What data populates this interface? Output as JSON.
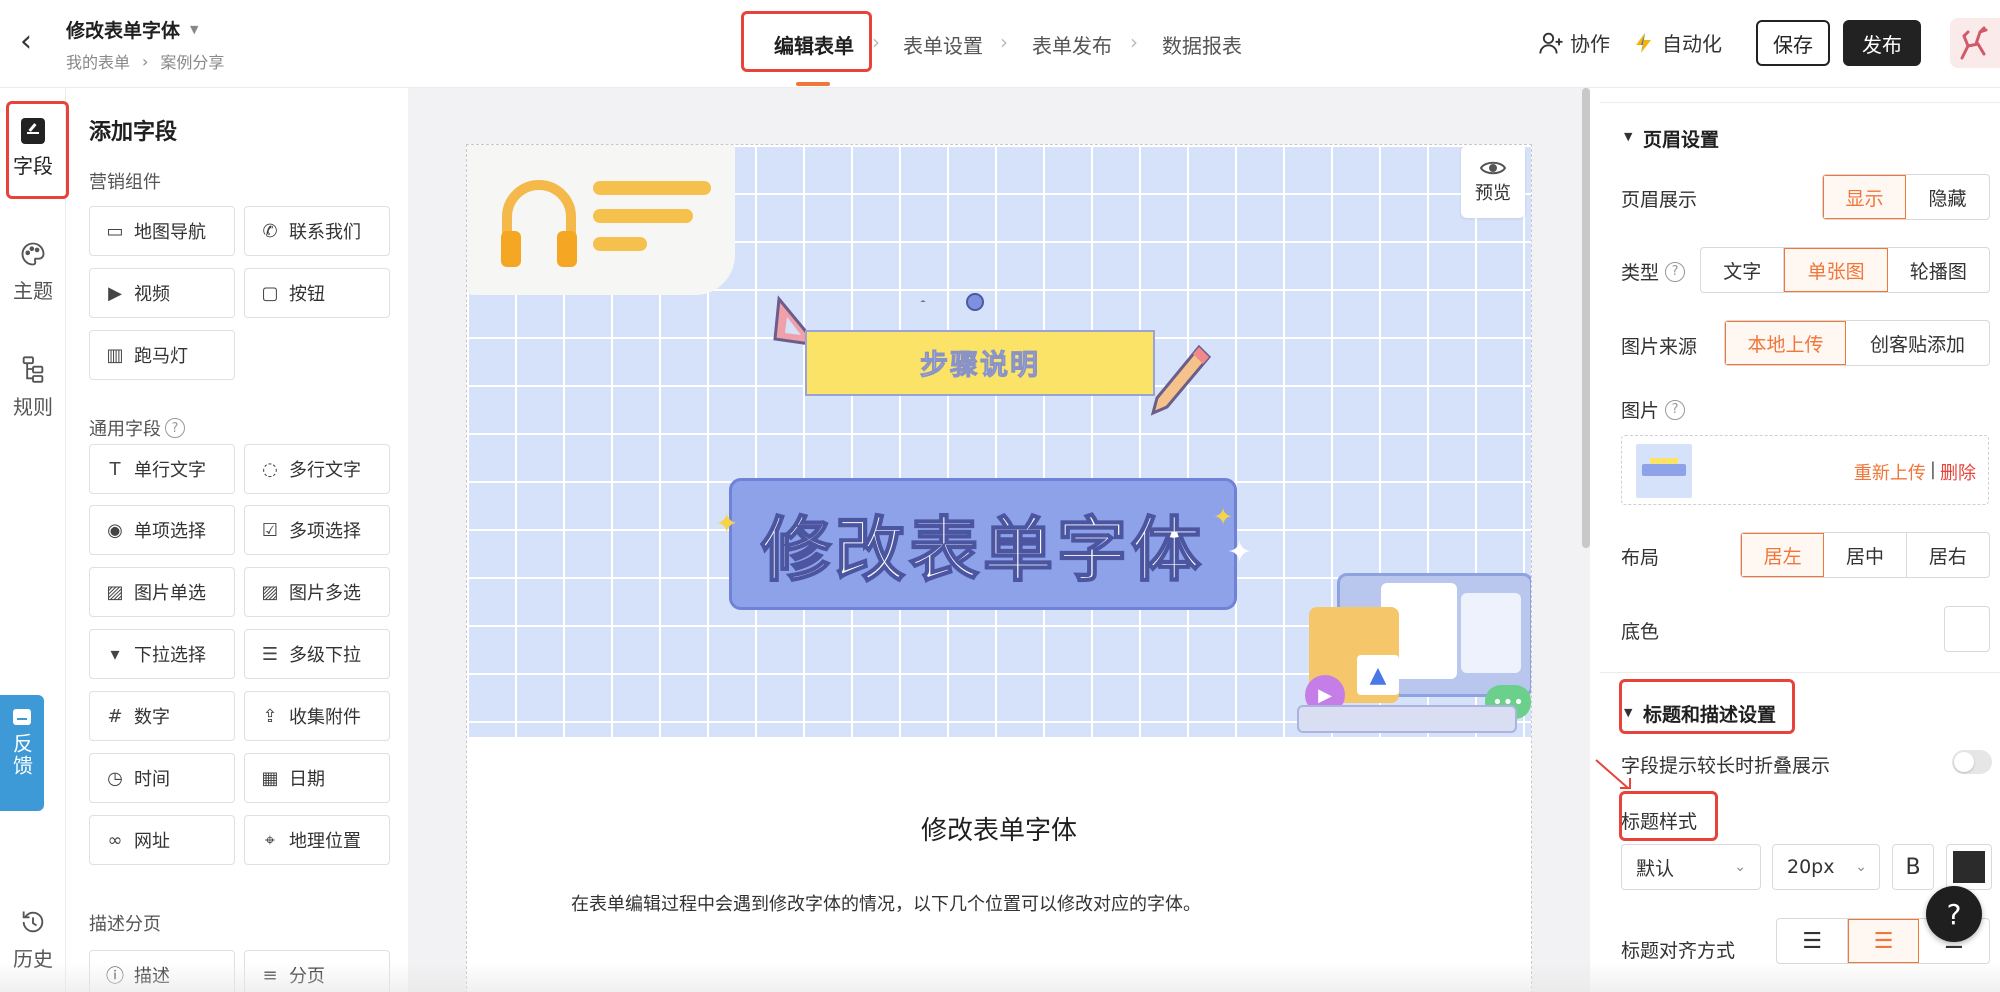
{
  "header": {
    "form_title": "修改表单字体",
    "breadcrumb": [
      "我的表单",
      "案例分享"
    ],
    "steps": [
      "编辑表单",
      "表单设置",
      "表单发布",
      "数据报表"
    ],
    "collab_label": "协作",
    "automation_label": "自动化",
    "save_label": "保存",
    "publish_label": "发布"
  },
  "rail": {
    "items": [
      {
        "label": "字段",
        "icon": "edit-doc-icon"
      },
      {
        "label": "主题",
        "icon": "palette-icon"
      },
      {
        "label": "规则",
        "icon": "rule-tree-icon"
      },
      {
        "label": "历史",
        "icon": "history-icon"
      }
    ],
    "feedback_label": "反馈"
  },
  "palette": {
    "title": "添加字段",
    "sections": [
      {
        "label": "营销组件",
        "items": [
          {
            "label": "地图导航",
            "icon": "map-icon"
          },
          {
            "label": "联系我们",
            "icon": "phone-icon"
          },
          {
            "label": "视频",
            "icon": "video-icon"
          },
          {
            "label": "按钮",
            "icon": "button-icon"
          },
          {
            "label": "跑马灯",
            "icon": "marquee-icon"
          }
        ]
      },
      {
        "label": "通用字段",
        "items": [
          {
            "label": "单行文字",
            "icon": "text-icon"
          },
          {
            "label": "多行文字",
            "icon": "chat-icon"
          },
          {
            "label": "单项选择",
            "icon": "radio-icon"
          },
          {
            "label": "多项选择",
            "icon": "checkbox-icon"
          },
          {
            "label": "图片单选",
            "icon": "image-icon"
          },
          {
            "label": "图片多选",
            "icon": "images-icon"
          },
          {
            "label": "下拉选择",
            "icon": "dropdown-icon"
          },
          {
            "label": "多级下拉",
            "icon": "cascade-icon"
          },
          {
            "label": "数字",
            "icon": "number-icon"
          },
          {
            "label": "收集附件",
            "icon": "upload-icon"
          },
          {
            "label": "时间",
            "icon": "clock-icon"
          },
          {
            "label": "日期",
            "icon": "calendar-icon"
          },
          {
            "label": "网址",
            "icon": "link-icon"
          },
          {
            "label": "地理位置",
            "icon": "location-icon"
          }
        ]
      },
      {
        "label": "描述分页",
        "items": [
          {
            "label": "描述",
            "icon": "info-icon"
          },
          {
            "label": "分页",
            "icon": "page-break-icon"
          }
        ]
      }
    ]
  },
  "canvas": {
    "preview_label": "预览",
    "banner_sign": "步骤说明",
    "banner_title": "修改表单字体",
    "form_title": "修改表单字体",
    "form_desc": "在表单编辑过程中会遇到修改字体的情况，以下几个位置可以修改对应的字体。"
  },
  "panel": {
    "header_section": "页眉设置",
    "header_show_label": "页眉展示",
    "header_show_options": [
      "显示",
      "隐藏"
    ],
    "type_label": "类型",
    "type_options": [
      "文字",
      "单张图",
      "轮播图"
    ],
    "source_label": "图片来源",
    "source_options": [
      "本地上传",
      "创客贴添加"
    ],
    "image_label": "图片",
    "reupload_label": "重新上传",
    "separator": "|",
    "delete_label": "删除",
    "layout_label": "布局",
    "layout_options": [
      "居左",
      "居中",
      "居右"
    ],
    "bg_label": "底色",
    "title_section": "标题和描述设置",
    "fold_label": "字段提示较长时折叠展示",
    "title_style_label": "标题样式",
    "font_value": "默认",
    "size_value": "20px",
    "bold_label": "B",
    "align_label": "标题对齐方式",
    "help_label": "?"
  },
  "colors": {
    "accent": "#f0763a",
    "annotation": "#e8433b",
    "feedback": "#3d9ad6",
    "banner_bg": "#d6e2fa"
  }
}
